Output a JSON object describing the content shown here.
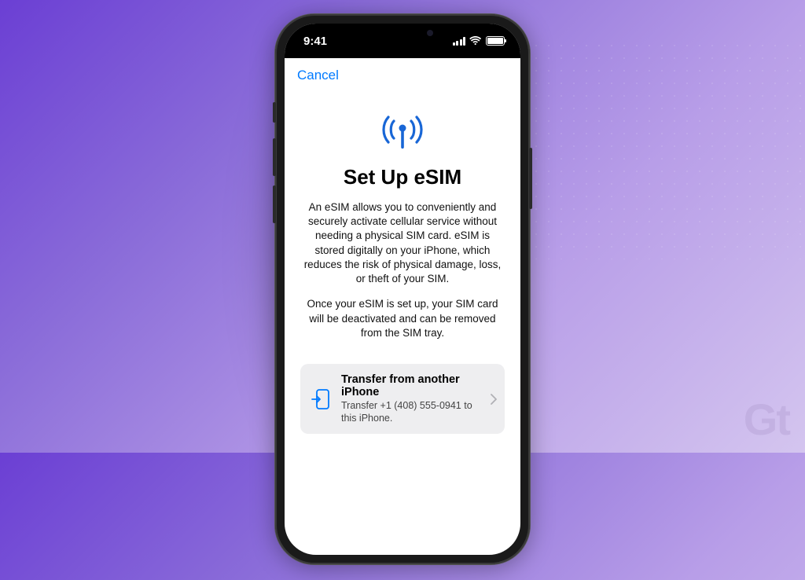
{
  "status": {
    "time": "9:41"
  },
  "nav": {
    "cancel": "Cancel"
  },
  "page": {
    "title": "Set Up eSIM",
    "description1": "An eSIM allows you to conveniently and securely activate cellular service without needing a physical SIM card. eSIM is stored digitally on your iPhone, which reduces the risk of physical damage, loss, or theft of your SIM.",
    "description2": "Once your eSIM is set up, your SIM card will be deactivated and can be removed from the SIM tray."
  },
  "option": {
    "title": "Transfer from another iPhone",
    "subtitle": "Transfer +1 (408) 555-0941 to this iPhone."
  },
  "watermark": "Gt",
  "colors": {
    "accent": "#007aff"
  }
}
